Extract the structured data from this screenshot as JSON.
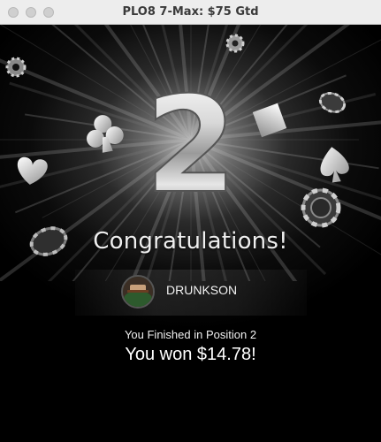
{
  "window": {
    "title": "PLO8 7-Max: $75 Gtd"
  },
  "hero": {
    "place_number": "2",
    "icons": [
      "club-icon",
      "heart-icon",
      "diamond-icon",
      "spade-icon",
      "poker-chip-icon",
      "gear-icon"
    ]
  },
  "result": {
    "headline": "Congratulations!",
    "player_name": "DRUNKSON",
    "position_text": "You Finished in Position 2",
    "winnings_text": "You won $14.78!"
  },
  "colors": {
    "background": "#000000",
    "titlebar": "#ededed",
    "text": "#f0f0f0"
  }
}
